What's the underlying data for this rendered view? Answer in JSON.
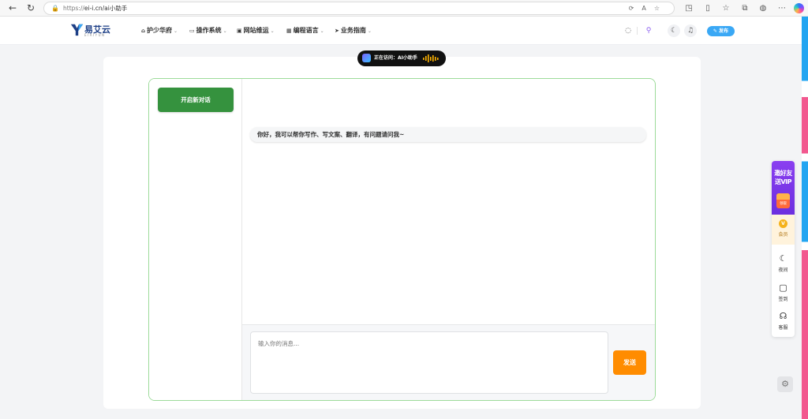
{
  "browser": {
    "scheme": "https://",
    "host_path": "ei-i.cn/ai小助手"
  },
  "site": {
    "logo_text": "易艾云",
    "logo_subtitle": "EIAIYUN",
    "nav": [
      {
        "icon": "home-icon",
        "label": "护少华府"
      },
      {
        "icon": "laptop-icon",
        "label": "操作系统"
      },
      {
        "icon": "monitor-icon",
        "label": "网站维运"
      },
      {
        "icon": "grid-icon",
        "label": "编程语言"
      },
      {
        "icon": "send-icon",
        "label": "业务指南"
      }
    ],
    "publish_label": "发布"
  },
  "visit_banner": {
    "text": "正在访问：AI小助手"
  },
  "chat": {
    "new_chat_label": "开启新对话",
    "greeting": "你好，我可以帮你写作、写文案、翻译，有问题请问我~",
    "input_placeholder": "输入你的消息...",
    "send_label": "发送"
  },
  "float_bar": {
    "promo_line1": "邀好友",
    "promo_line2": "送VIP",
    "promo_gift": "领取",
    "member_label": "会员",
    "night_label": "夜间",
    "signin_label": "签到",
    "service_label": "客服"
  },
  "colors": {
    "accent_green": "#35923e",
    "frame_border": "#9ddb9a",
    "send_orange": "#ff8c00",
    "publish_blue": "#3aa8f5",
    "promo_purple": "#7a38ea"
  }
}
